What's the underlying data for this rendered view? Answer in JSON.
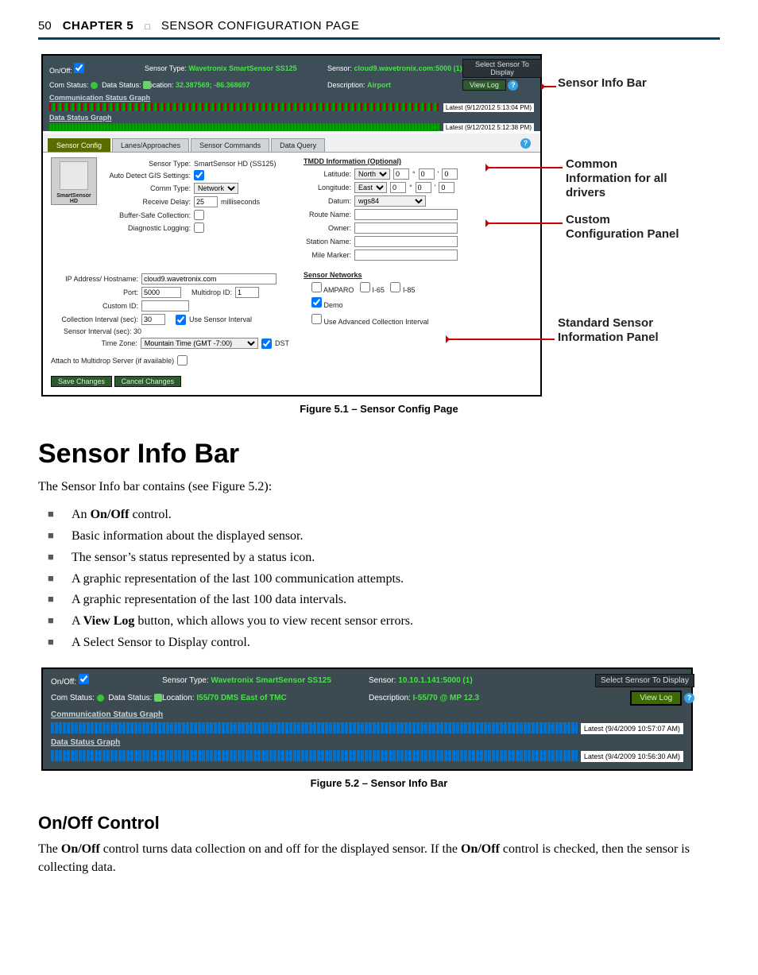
{
  "header": {
    "page": "50",
    "chapter": "CHAPTER 5",
    "title": "SENSOR CONFIGURATION PAGE"
  },
  "fig1": {
    "caption": "Figure 5.1 – Sensor Config Page",
    "top": {
      "onoff_label": "On/Off:",
      "sensortype_label": "Sensor Type:",
      "sensortype": "Wavetronix SmartSensor SS125",
      "sensor_label": "Sensor:",
      "sensor": "cloud9.wavetronix.com:5000 (1)",
      "select_btn": "Select Sensor To Display",
      "com_label": "Com Status:",
      "data_label": "Data Status:",
      "loc_label": "Location:",
      "loc": "32.387569; -86.368697",
      "desc_label": "Description:",
      "desc": "Airport",
      "viewlog_btn": "View Log",
      "comm_graph_label": "Communication Status Graph",
      "data_graph_label": "Data Status Graph",
      "ts1": "Latest (9/12/2012 5:13:04 PM)",
      "ts2": "Latest (9/12/2012 5:12:38 PM)"
    },
    "tabs": [
      "Sensor Config",
      "Lanes/Approaches",
      "Sensor Commands",
      "Data Query"
    ],
    "left": {
      "thumb_label": "SmartSensor\nHD",
      "sensor_type_label": "Sensor Type:",
      "sensor_type": "SmartSensor HD (SS125)",
      "auto_label": "Auto Detect GIS Settings:",
      "comm_label": "Comm Type:",
      "comm_val": "Network",
      "recv_label": "Receive Delay:",
      "recv_val": "25",
      "recv_unit": "milliseconds",
      "buf_label": "Buffer-Safe Collection:",
      "diag_label": "Diagnostic Logging:"
    },
    "tmdd": {
      "title": "TMDD Information (Optional)",
      "lat_label": "Latitude:",
      "lat_dir": "North",
      "lon_label": "Longitude:",
      "lon_dir": "East",
      "datum_label": "Datum:",
      "datum": "wgs84",
      "route_label": "Route Name:",
      "owner_label": "Owner:",
      "station_label": "Station Name:",
      "mile_label": "Mile Marker:"
    },
    "net_left": {
      "ip_label": "IP Address/ Hostname:",
      "ip_val": "cloud9.wavetronix.com",
      "port_label": "Port:",
      "port_val": "5000",
      "multi_label": "Multidrop ID:",
      "multi_val": "1",
      "custom_label": "Custom ID:",
      "coll_label": "Collection Interval (sec):",
      "coll_val": "30",
      "use_sensor_label": "Use Sensor Interval",
      "sensor_int_label": "Sensor Interval (sec): 30",
      "tz_label": "Time Zone:",
      "tz_val": "Mountain Time (GMT -7:00)",
      "dst_label": "DST",
      "attach_label": "Attach to Multidrop Server (if available)"
    },
    "net_right": {
      "title": "Sensor Networks",
      "opt1": "AMPARO",
      "opt2": "I-65",
      "opt3": "I-85",
      "opt4": "Demo",
      "adv_label": "Use Advanced Collection Interval"
    },
    "buttons": {
      "save": "Save Changes",
      "cancel": "Cancel Changes"
    },
    "callouts": {
      "c1": "Sensor Info Bar",
      "c2": "Common Information for all drivers",
      "c3": "Custom Configuration Panel",
      "c4": "Standard Sensor Information Panel"
    }
  },
  "sec1": {
    "heading": "Sensor Info Bar",
    "intro": "The Sensor Info bar contains (see Figure 5.2):",
    "items": [
      {
        "pre": "An ",
        "b": "On/Off",
        "post": " control."
      },
      {
        "pre": "Basic information about the displayed sensor."
      },
      {
        "pre": "The sensor’s status represented by a status icon."
      },
      {
        "pre": "A graphic representation of the last 100 communication attempts."
      },
      {
        "pre": "A graphic representation of the last 100 data intervals."
      },
      {
        "pre": "A ",
        "b": "View Log",
        "post": " button, which allows you to view recent sensor errors."
      },
      {
        "pre": "A Select Sensor to Display control."
      }
    ]
  },
  "fig2": {
    "caption": "Figure 5.2 – Sensor Info Bar",
    "onoff_label": "On/Off:",
    "sensortype_label": "Sensor Type:",
    "sensortype": "Wavetronix SmartSensor SS125",
    "sensor_label": "Sensor:",
    "sensor": "10.10.1.141:5000 (1)",
    "select_btn": "Select Sensor To Display",
    "com_label": "Com Status:",
    "data_label": "Data Status:",
    "loc_label": "Location:",
    "loc": "I55/70 DMS East of TMC",
    "desc_label": "Description:",
    "desc": "I-55/70 @ MP 12.3",
    "viewlog_btn": "View Log",
    "comm_graph_label": "Communication Status Graph",
    "data_graph_label": "Data Status Graph",
    "ts1": "Latest (9/4/2009 10:57:07 AM)",
    "ts2": "Latest (9/4/2009 10:56:30 AM)"
  },
  "sec2": {
    "heading": "On/Off Control",
    "p_pre": "The ",
    "p_b1": "On/Off",
    "p_mid": " control turns data collection on and off for the displayed sensor. If the ",
    "p_b2": "On/Off",
    "p_post": " control is checked, then the sensor is collecting data."
  }
}
